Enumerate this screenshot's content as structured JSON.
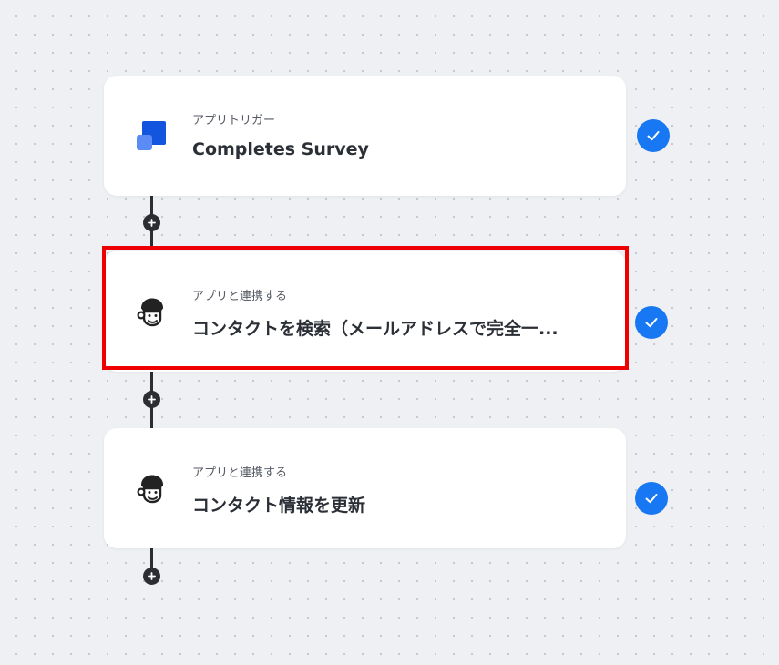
{
  "flow": {
    "steps": [
      {
        "subtitle": "アプリトリガー",
        "title": "Completes Survey",
        "icon": "survey-app-icon",
        "status": "completed"
      },
      {
        "subtitle": "アプリと連携する",
        "title": "コンタクトを検索（メールアドレスで完全一...",
        "icon": "mailchimp-icon",
        "status": "completed",
        "highlighted": true
      },
      {
        "subtitle": "アプリと連携する",
        "title": "コンタクト情報を更新",
        "icon": "mailchimp-icon",
        "status": "completed"
      }
    ]
  },
  "colors": {
    "background": "#eef0f3",
    "check": "#1877f2",
    "connector": "#2b2d33",
    "highlight": "#ee0000",
    "survey_icon_dark": "#1455e0",
    "survey_icon_light": "#5b8cf5"
  }
}
